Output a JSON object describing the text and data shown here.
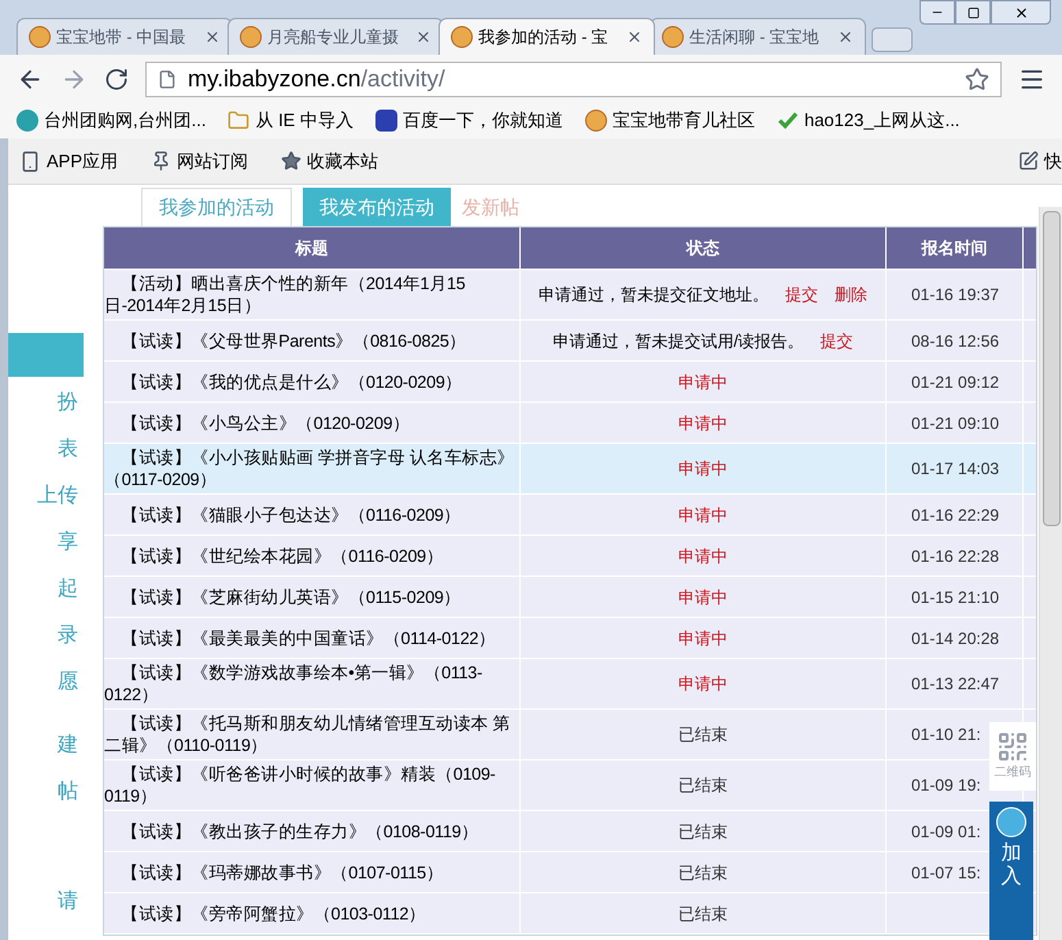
{
  "browser": {
    "tabs": [
      {
        "title": "宝宝地带 - 中国最",
        "selected": false
      },
      {
        "title": "月亮船专业儿童摄",
        "selected": false
      },
      {
        "title": "我参加的活动 - 宝",
        "selected": true
      },
      {
        "title": "生活闲聊 - 宝宝地",
        "selected": false
      }
    ],
    "url": {
      "host": "my.ibabyzone.cn",
      "path": "/activity/"
    },
    "bookmarks": [
      {
        "label": "台州团购网,台州团...",
        "kind": "globe"
      },
      {
        "label": "从 IE 中导入",
        "kind": "folder"
      },
      {
        "label": "百度一下，你就知道",
        "kind": "paw"
      },
      {
        "label": "宝宝地带育儿社区",
        "kind": "site"
      },
      {
        "label": "hao123_上网从这...",
        "kind": "check"
      }
    ]
  },
  "page_toolbar": {
    "items": [
      {
        "label": "APP应用",
        "kind": "phone"
      },
      {
        "label": "网站订阅",
        "kind": "pin"
      },
      {
        "label": "收藏本站",
        "kind": "star"
      }
    ],
    "right_item": "快"
  },
  "sidebar": {
    "items": [
      {
        "selected": true
      },
      {
        "label": "扮",
        "selected": false
      },
      {
        "label": "表",
        "selected": false
      },
      {
        "label": "上传",
        "selected": false
      },
      {
        "label": "享",
        "selected": false
      },
      {
        "label": "起",
        "selected": false
      },
      {
        "label": "录",
        "selected": false
      },
      {
        "label": "愿",
        "selected": false
      },
      {
        "label": "建",
        "selected": false
      },
      {
        "label": "帖",
        "selected": false
      },
      {
        "label": "请",
        "selected": false
      }
    ]
  },
  "tabs": [
    {
      "label": "我参加的活动",
      "selected": false
    },
    {
      "label": "我发布的活动",
      "selected": true
    }
  ],
  "new_post_link": "发新帖",
  "table": {
    "columns": [
      "标题",
      "状态",
      "报名时间"
    ],
    "rows": [
      {
        "title": "【活动】晒出喜庆个性的新年（2014年1月15日-2014年2月15日）",
        "status": {
          "kind": "approved",
          "text": "申请通过，暂未提交征文地址。",
          "links": [
            "提交",
            "删除"
          ]
        },
        "time": "01-16 19:37",
        "selected": false
      },
      {
        "title": "【试读】《父母世界Parents》（0816-0825）",
        "status": {
          "kind": "approved",
          "text": "申请通过，暂未提交试用/读报告。",
          "links": [
            "提交"
          ]
        },
        "time": "08-16 12:56",
        "selected": false
      },
      {
        "title": "【试读】《我的优点是什么》（0120-0209）",
        "status": {
          "kind": "pending",
          "text": "申请中"
        },
        "time": "01-21 09:12",
        "selected": false
      },
      {
        "title": "【试读】《小鸟公主》（0120-0209）",
        "status": {
          "kind": "pending",
          "text": "申请中"
        },
        "time": "01-21 09:10",
        "selected": false
      },
      {
        "title": "【试读】《小小孩贴贴画 学拼音字母 认名车标志》（0117-0209）",
        "status": {
          "kind": "pending",
          "text": "申请中"
        },
        "time": "01-17 14:03",
        "selected": true
      },
      {
        "title": "【试读】《猫眼小子包达达》（0116-0209）",
        "status": {
          "kind": "pending",
          "text": "申请中"
        },
        "time": "01-16 22:29",
        "selected": false
      },
      {
        "title": "【试读】《世纪绘本花园》（0116-0209）",
        "status": {
          "kind": "pending",
          "text": "申请中"
        },
        "time": "01-16 22:28",
        "selected": false
      },
      {
        "title": "【试读】《芝麻街幼儿英语》（0115-0209）",
        "status": {
          "kind": "pending",
          "text": "申请中"
        },
        "time": "01-15 21:10",
        "selected": false
      },
      {
        "title": "【试读】《最美最美的中国童话》（0114-0122）",
        "status": {
          "kind": "pending",
          "text": "申请中"
        },
        "time": "01-14 20:28",
        "selected": false
      },
      {
        "title": "【试读】《数学游戏故事绘本•第一辑》（0113-0122）",
        "status": {
          "kind": "pending",
          "text": "申请中"
        },
        "time": "01-13 22:47",
        "selected": false
      },
      {
        "title": "【试读】《托马斯和朋友幼儿情绪管理互动读本 第二辑》（0110-0119）",
        "status": {
          "kind": "ended",
          "text": "已结束"
        },
        "time": "01-10 21:",
        "selected": false
      },
      {
        "title": "【试读】《听爸爸讲小时候的故事》精装（0109-0119）",
        "status": {
          "kind": "ended",
          "text": "已结束"
        },
        "time": "01-09 19:",
        "selected": false
      },
      {
        "title": "【试读】《教出孩子的生存力》（0108-0119）",
        "status": {
          "kind": "ended",
          "text": "已结束"
        },
        "time": "01-09 01:",
        "selected": false
      },
      {
        "title": "【试读】《玛蒂娜故事书》（0107-0115）",
        "status": {
          "kind": "ended",
          "text": "已结束"
        },
        "time": "01-07 15:",
        "selected": false
      },
      {
        "title": "【试读】《旁帝阿蟹拉》（0103-0112）",
        "status": {
          "kind": "ended",
          "text": "已结束"
        },
        "selected": false
      }
    ]
  },
  "float": {
    "qr_label": "二维码",
    "join_label": "加入"
  }
}
